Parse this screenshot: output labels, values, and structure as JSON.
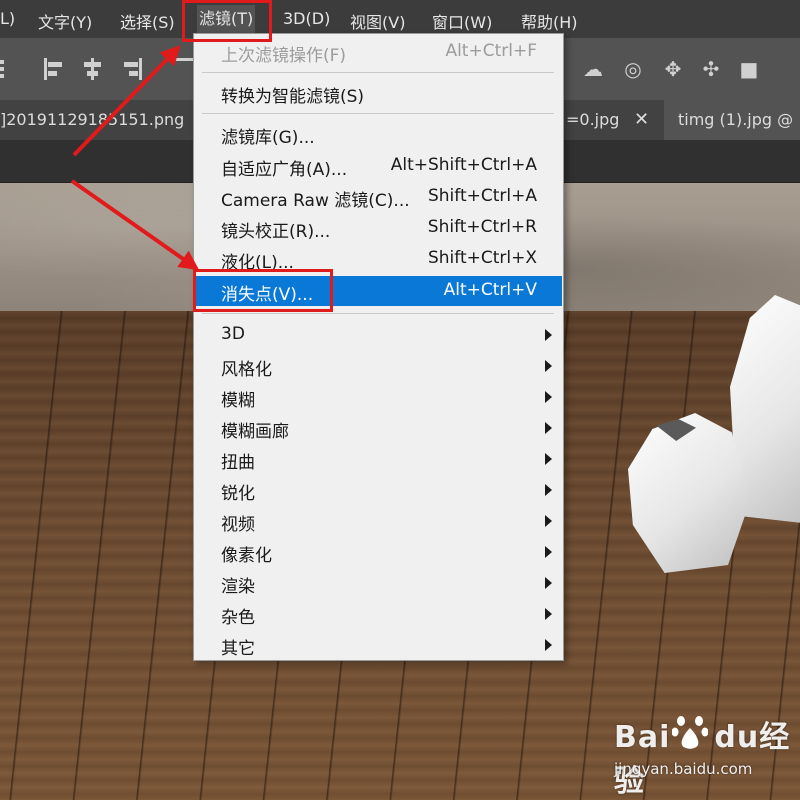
{
  "menubar": {
    "items": [
      {
        "label": "L)"
      },
      {
        "label": "文字(Y)"
      },
      {
        "label": "选择(S)"
      },
      {
        "label": "滤镜(T)"
      },
      {
        "label": "3D(D)"
      },
      {
        "label": "视图(V)"
      },
      {
        "label": "窗口(W)"
      },
      {
        "label": "帮助(H)"
      }
    ]
  },
  "tabs": {
    "items": [
      {
        "label": "]20191129185151.png"
      },
      {
        "label": "=0.jpg"
      },
      {
        "label": "timg (1).jpg @"
      }
    ],
    "close_glyph": "✕"
  },
  "filter_menu": {
    "items": [
      {
        "label": "上次滤镜操作(F)",
        "shortcut": "Alt+Ctrl+F",
        "disabled": true
      },
      {
        "label": "转换为智能滤镜(S)",
        "shortcut": ""
      },
      {
        "label": "滤镜库(G)...",
        "shortcut": ""
      },
      {
        "label": "自适应广角(A)...",
        "shortcut": "Alt+Shift+Ctrl+A"
      },
      {
        "label": "Camera Raw 滤镜(C)...",
        "shortcut": "Shift+Ctrl+A"
      },
      {
        "label": "镜头校正(R)...",
        "shortcut": "Shift+Ctrl+R"
      },
      {
        "label": "液化(L)...",
        "shortcut": "Shift+Ctrl+X"
      },
      {
        "label": "消失点(V)...",
        "shortcut": "Alt+Ctrl+V",
        "highlighted": true
      },
      {
        "label": "3D",
        "submenu": true
      },
      {
        "label": "风格化",
        "submenu": true
      },
      {
        "label": "模糊",
        "submenu": true
      },
      {
        "label": "模糊画廊",
        "submenu": true
      },
      {
        "label": "扭曲",
        "submenu": true
      },
      {
        "label": "锐化",
        "submenu": true
      },
      {
        "label": "视频",
        "submenu": true
      },
      {
        "label": "像素化",
        "submenu": true
      },
      {
        "label": "渲染",
        "submenu": true
      },
      {
        "label": "杂色",
        "submenu": true
      },
      {
        "label": "其它",
        "submenu": true
      }
    ]
  },
  "watermark": {
    "brand": "Bai",
    "brand2": "经验",
    "brand_du": "du",
    "sub": "jingyan.baidu.com"
  },
  "colors": {
    "highlight": "#0a78d7",
    "annotation": "#e11b1b"
  }
}
